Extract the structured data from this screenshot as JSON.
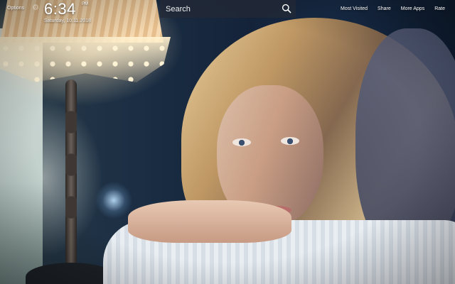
{
  "header": {
    "options_label": "Options",
    "settings_icon": "gear-icon",
    "time": "6:34",
    "meridiem": "PM",
    "date": "Saturday, 10.11.2018"
  },
  "search": {
    "placeholder": "Search",
    "icon": "search-icon"
  },
  "nav": {
    "most_visited": "Most Visited",
    "share": "Share",
    "more_apps": "More Apps",
    "rate": "Rate"
  },
  "background": {
    "description_colors": {
      "night": "#15263a",
      "lamp": "#f6d9b0",
      "sweater": "#e9eef3"
    }
  }
}
